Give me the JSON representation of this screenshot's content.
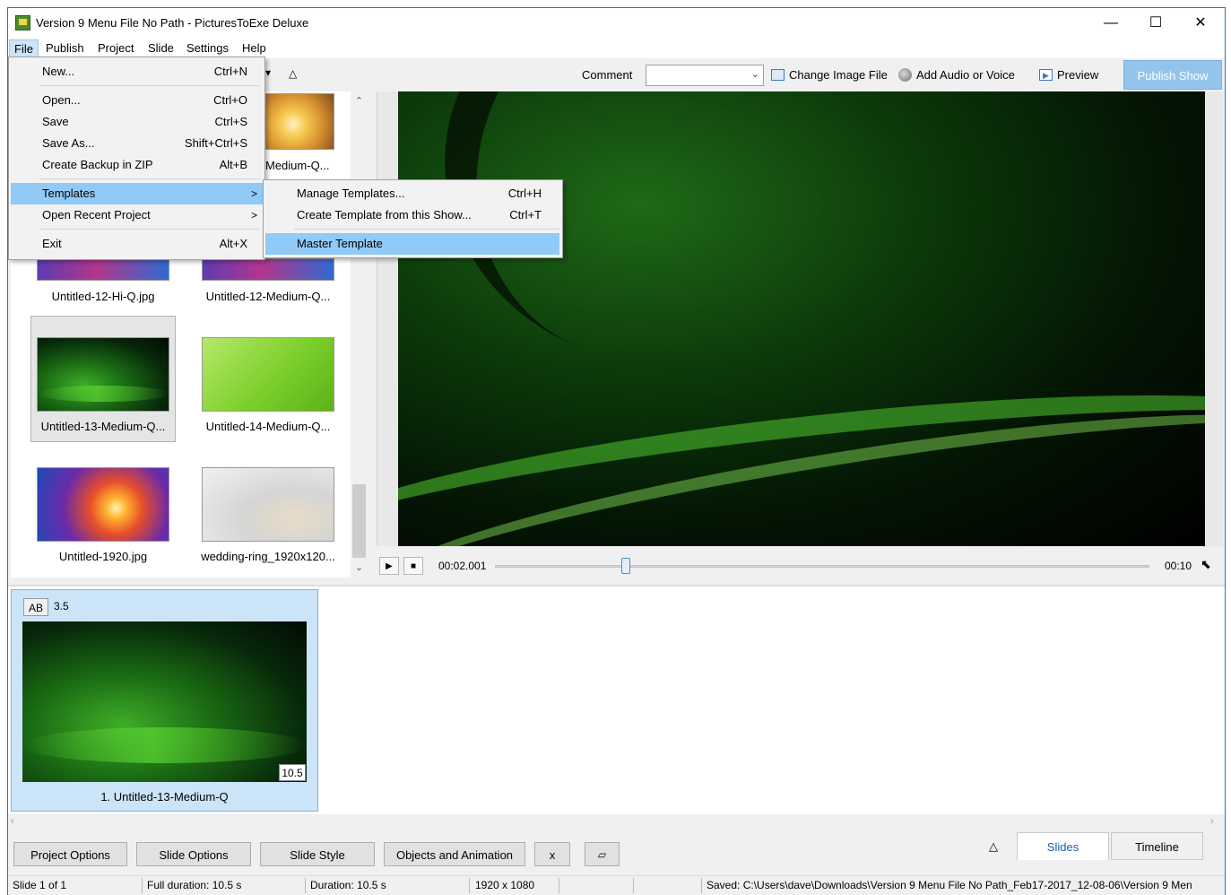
{
  "window": {
    "title": "Version 9 Menu File No Path - PicturesToExe Deluxe"
  },
  "menubar": [
    "File",
    "Publish",
    "Project",
    "Slide",
    "Settings",
    "Help"
  ],
  "toolbar": {
    "comment_label": "Comment",
    "comment_value": "",
    "change_image": "Change Image File",
    "add_audio": "Add Audio or Voice",
    "preview": "Preview",
    "publish_show": "Publish Show"
  },
  "file_menu": {
    "items": [
      {
        "label": "New...",
        "shortcut": "Ctrl+N"
      },
      {
        "label": "Open...",
        "shortcut": "Ctrl+O"
      },
      {
        "label": "Save",
        "shortcut": "Ctrl+S"
      },
      {
        "label": "Save As...",
        "shortcut": "Shift+Ctrl+S"
      },
      {
        "label": "Create Backup in ZIP",
        "shortcut": "Alt+B"
      },
      {
        "label": "Templates",
        "shortcut": ""
      },
      {
        "label": "Open Recent Project",
        "shortcut": ""
      },
      {
        "label": "Exit",
        "shortcut": "Alt+X"
      }
    ]
  },
  "templates_submenu": {
    "items": [
      {
        "label": "Manage Templates...",
        "shortcut": "Ctrl+H"
      },
      {
        "label": "Create Template from this Show...",
        "shortcut": "Ctrl+T"
      },
      {
        "label": "Master Template",
        "shortcut": ""
      }
    ]
  },
  "thumbnails": [
    {
      "name": "Medium-Q..."
    },
    {
      "name": "Untitled-12-Hi-Q.jpg"
    },
    {
      "name": "Untitled-12-Medium-Q..."
    },
    {
      "name": "Untitled-13-Medium-Q..."
    },
    {
      "name": "Untitled-14-Medium-Q..."
    },
    {
      "name": "Untitled-1920.jpg"
    },
    {
      "name": "wedding-ring_1920x120..."
    }
  ],
  "player": {
    "current_time": "00:02.001",
    "end_time": "00:10",
    "position_fraction": 0.2
  },
  "slide": {
    "badge": "AB",
    "transition_duration": "3.5",
    "duration": "10.5",
    "caption": "1. Untitled-13-Medium-Q"
  },
  "bottom_buttons": [
    "Project Options",
    "Slide Options",
    "Slide Style",
    "Objects and Animation",
    "x"
  ],
  "tabs": {
    "slides": "Slides",
    "timeline": "Timeline"
  },
  "status": {
    "slide": "Slide 1 of 1",
    "full_duration": "Full duration: 10.5 s",
    "duration": "Duration: 10.5 s",
    "resolution": "1920 x 1080",
    "saved": "Saved: C:\\Users\\dave\\Downloads\\Version 9 Menu File No Path_Feb17-2017_12-08-06\\Version 9 Men"
  }
}
